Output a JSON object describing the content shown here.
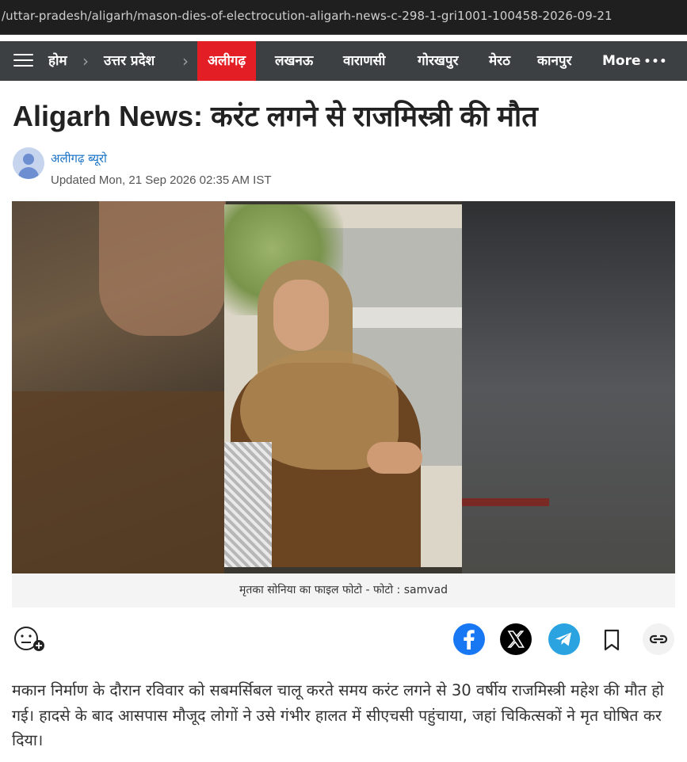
{
  "browser": {
    "url": "/uttar-pradesh/aligarh/mason-dies-of-electrocution-aligarh-news-c-298-1-gri1001-100458-2026-09-21"
  },
  "nav": {
    "home": "होम",
    "state": "उत्तर प्रदेश",
    "active_city": "अलीगढ़",
    "items": [
      "लखनऊ",
      "वाराणसी",
      "गोरखपुर",
      "मेरठ",
      "कानपुर"
    ],
    "more": "More",
    "more_dots": "•••",
    "separator": "›"
  },
  "article": {
    "headline": "Aligarh News: करंट लगने से राजमिस्त्री की मौत",
    "author": "अलीगढ़ ब्यूरो",
    "updated": "Updated Mon, 21 Sep 2026 02:35 AM IST",
    "image_caption": "मृतका सोनिया का फाइल फोटो  - फोटो : samvad",
    "body": "मकान निर्माण के दौरान रविवार को सबमर्सिबल चालू करते समय करंट लगने से 30 वर्षीय राजमिस्त्री महेश की मौत हो गई। हादसे के बाद आसपास मौजूद लोगों ने उसे गंभीर हालत में सीएचसी पहुंचाया, जहां चिकित्सकों ने मृत घोषित कर दिया।"
  },
  "icons": {
    "reaction": "add-reaction-icon",
    "facebook": "facebook-icon",
    "x": "x-icon",
    "telegram": "telegram-icon",
    "bookmark": "bookmark-icon",
    "link": "link-icon"
  },
  "colors": {
    "nav_bg": "#3c4043",
    "active_red": "#e31e24",
    "facebook": "#1877f2",
    "telegram": "#2aa3e0",
    "author_link": "#1a73c6"
  }
}
